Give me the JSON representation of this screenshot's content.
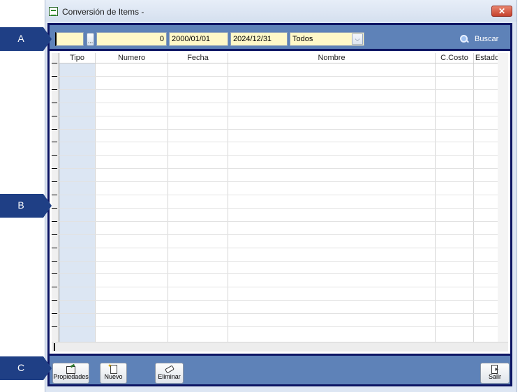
{
  "window": {
    "title": "Conversión de Items -",
    "close_label": "✕"
  },
  "callouts": [
    "A",
    "B",
    "C"
  ],
  "filter": {
    "code_value": "",
    "number_value": "0",
    "date_from": "2000/01/01",
    "date_to": "2024/12/31",
    "status_selected": "Todos",
    "dots_label": "...",
    "search_label": "Buscar"
  },
  "grid": {
    "columns": [
      "Tipo",
      "Numero",
      "Fecha",
      "Nombre",
      "C.Costo",
      "Estado"
    ],
    "row_count": 21
  },
  "toolbar": {
    "properties_label": "Propiedades",
    "new_label": "Nuevo",
    "delete_label": "Eliminar",
    "exit_label": "Salir"
  }
}
